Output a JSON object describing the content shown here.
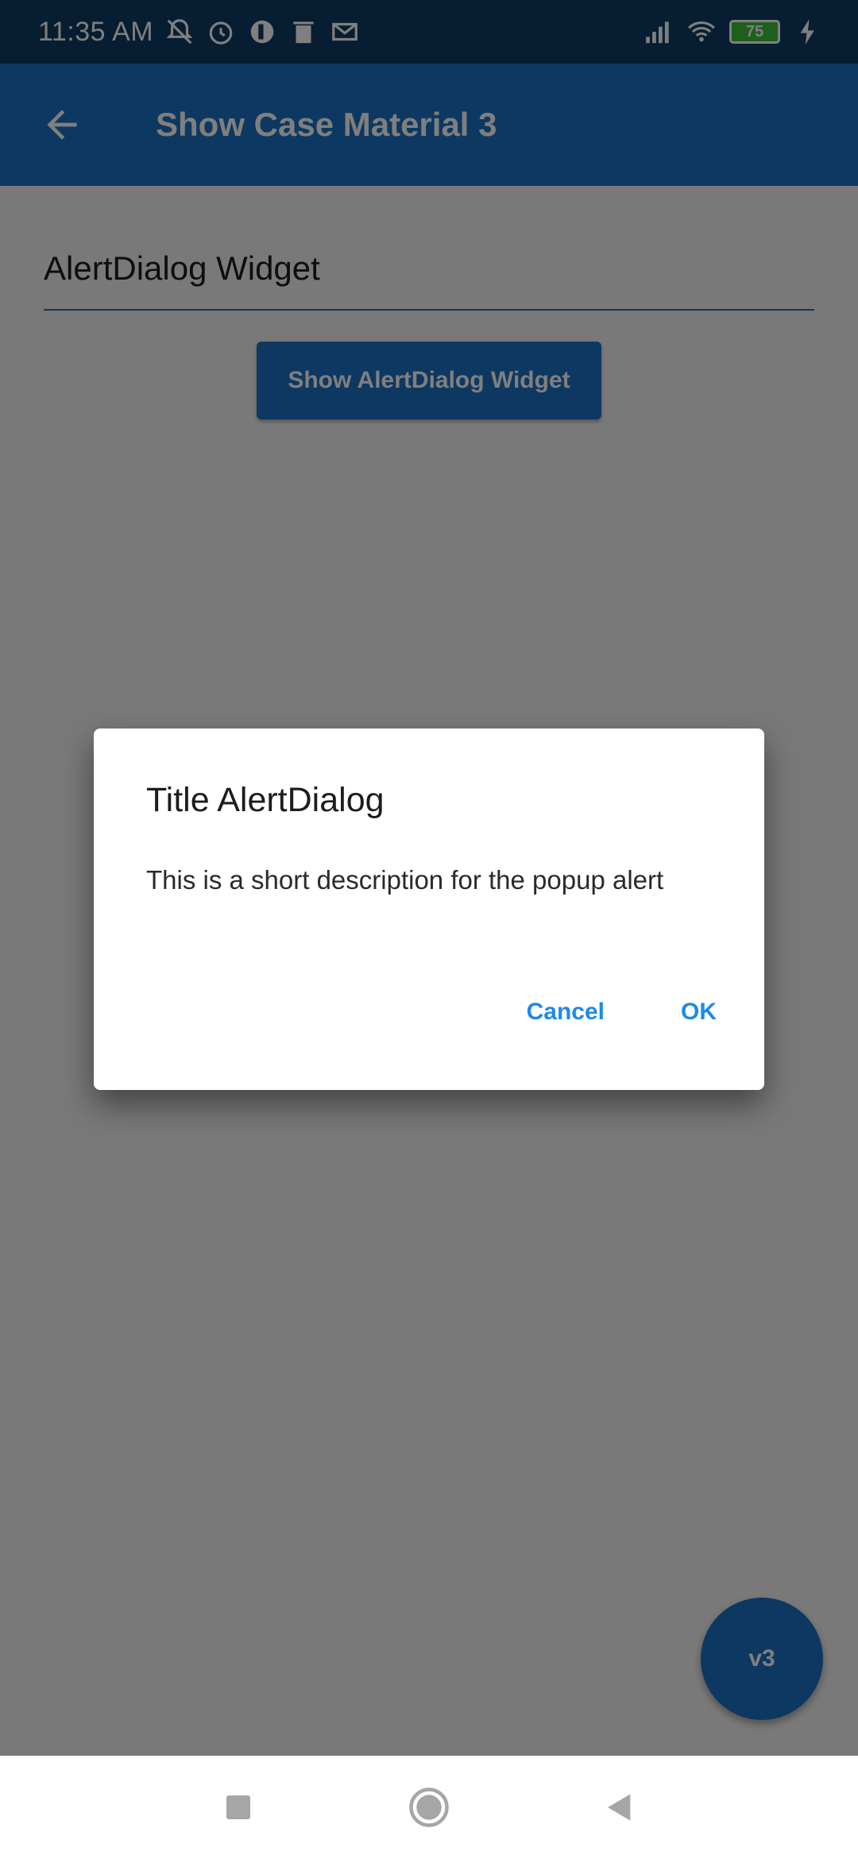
{
  "status_bar": {
    "time": "11:35 AM",
    "battery": "75",
    "icons_left": [
      "bell-off-icon",
      "alarm-icon",
      "app-icon",
      "trash-icon",
      "mail-icon"
    ],
    "icons_right": [
      "signal-icon",
      "wifi-icon",
      "battery-icon",
      "charging-icon"
    ]
  },
  "app_bar": {
    "title": "Show Case Material 3",
    "back_icon": "arrow-back-icon"
  },
  "main": {
    "section_title": "AlertDialog Widget",
    "show_button_label": "Show AlertDialog Widget",
    "fab_label": "v3"
  },
  "dialog": {
    "title": "Title AlertDialog",
    "description": "This is a short description for the popup alert",
    "cancel_label": "Cancel",
    "ok_label": "OK"
  },
  "nav_bar": {
    "buttons": [
      "recents-icon",
      "home-icon",
      "back-icon"
    ]
  },
  "colors": {
    "primary": "#1a70c2",
    "status_bar": "#0e3a62",
    "accent_text": "#1e8ae6",
    "scrim": "rgba(0,0,0,0.5)"
  }
}
